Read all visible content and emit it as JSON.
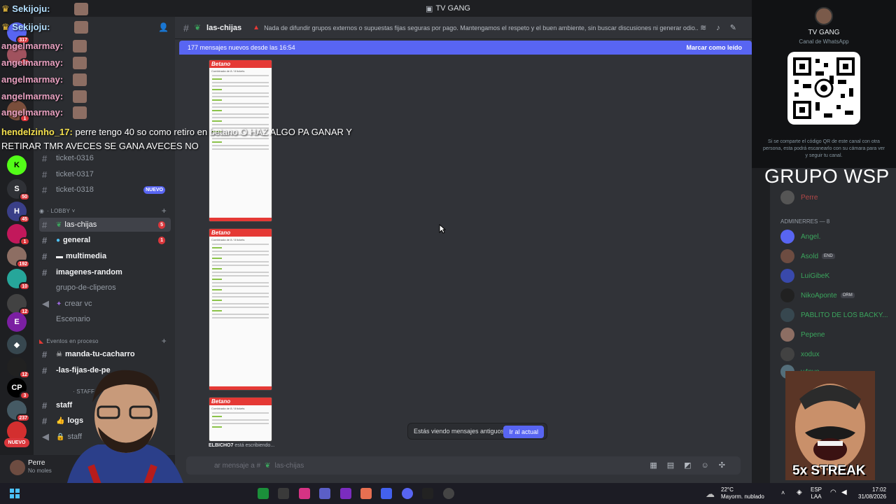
{
  "window": {
    "title": "TV GANG"
  },
  "rail": {
    "badges": [
      "317",
      "1",
      "1",
      "50",
      "45",
      "1",
      "192",
      "10",
      "12",
      "12",
      "3",
      "237"
    ],
    "new_label": "NUEVO"
  },
  "sidebar": {
    "channels_top": [
      {
        "label": "ticket-0316"
      },
      {
        "label": "ticket-0317"
      },
      {
        "label": "ticket-0318",
        "pill": "NUEVO"
      }
    ],
    "cat_lobby": "LOBBY",
    "lobby": [
      {
        "label": "las-chijas",
        "pill": "5"
      },
      {
        "label": "general",
        "pill": "1"
      },
      {
        "label": "multimedia"
      },
      {
        "label": "imagenes-random"
      },
      {
        "label": "grupo-de-cliperos"
      },
      {
        "label": "crear vc"
      },
      {
        "label": "Escenario"
      }
    ],
    "cat_events": "Eventos en proceso",
    "events": [
      {
        "label": "manda-tu-cacharro"
      },
      {
        "label": "-las-fijas-de-pe"
      }
    ],
    "cat_staff": "STAFF",
    "staff": [
      {
        "label": "staff"
      },
      {
        "label": "logs"
      },
      {
        "label": "staff"
      }
    ]
  },
  "user": {
    "name": "Perre",
    "status": "No moles"
  },
  "channel": {
    "name": "las-chijas",
    "topic": "Nada de difundir grupos externos o supuestas fijas seguras por pago. Mantengamos el respeto y el buen ambiente, sin buscar discusiones ni generar odio...",
    "new_messages": "177 mensajes nuevos desde las 16:54",
    "mark_read": "Marcar como leído",
    "ticket_brand": "Betano",
    "ticket_sub": "Combinada de 8 / 8 tickets",
    "typing_user": "ELBICHO7",
    "typing_text": " está escribiendo...",
    "old_notice": "Estás viendo mensajes antiguos",
    "jump_label": "Ir al actual",
    "composer_placeholder": "ar mensaje a #",
    "composer_channel": "las-chijas"
  },
  "members": {
    "top_member": "Perre",
    "category": "ADMINERRES — 8",
    "list": [
      {
        "name": "Angel.",
        "color": "#3ba55d"
      },
      {
        "name": "Asold",
        "tag": "END",
        "color": "#3ba55d"
      },
      {
        "name": "LuiGibeK",
        "color": "#3ba55d"
      },
      {
        "name": "NikoAponte",
        "tag": "ORM",
        "color": "#3ba55d"
      },
      {
        "name": "PABLITO DE LOS BACKY...",
        "color": "#3ba55d"
      },
      {
        "name": "Pepene",
        "color": "#3ba55d"
      },
      {
        "name": "xodux",
        "color": "#3ba55d"
      },
      {
        "name": "v4nyo",
        "color": "#3ba55d"
      }
    ]
  },
  "overlay": {
    "wa_title": "TV GANG",
    "wa_sub": "Canal de WhatsApp",
    "wa_text": "Si se comparte el código QR de este canal con otra persona, esta podrá escanearlo con su cámara para ver y seguir tu canal.",
    "grupo": "GRUPO WSP",
    "chat": [
      {
        "name": "Sekijoju:"
      },
      {
        "name": "Sekijoju:"
      },
      {
        "name": "angelmarmay:"
      },
      {
        "name": "angelmarmay:"
      },
      {
        "name": "angelmarmay:"
      },
      {
        "name": "angelmarmay:"
      },
      {
        "name": "angelmarmay:"
      }
    ],
    "msg_user": "hendelzinho_17:",
    "msg_line1": " perre tengo 40 so como retiro en betano O HAZ ALGO PA GANAR Y",
    "msg_line2": "RETIRAR TMR AVECES SE GANA AVECES NO",
    "streak": "5x STREAK"
  },
  "taskbar": {
    "weather_temp": "22°C",
    "weather_desc": "Mayorm. nublado",
    "lang1": "ESP",
    "lang2": "LAA",
    "time": "17:02",
    "date": "31/08/2026"
  }
}
